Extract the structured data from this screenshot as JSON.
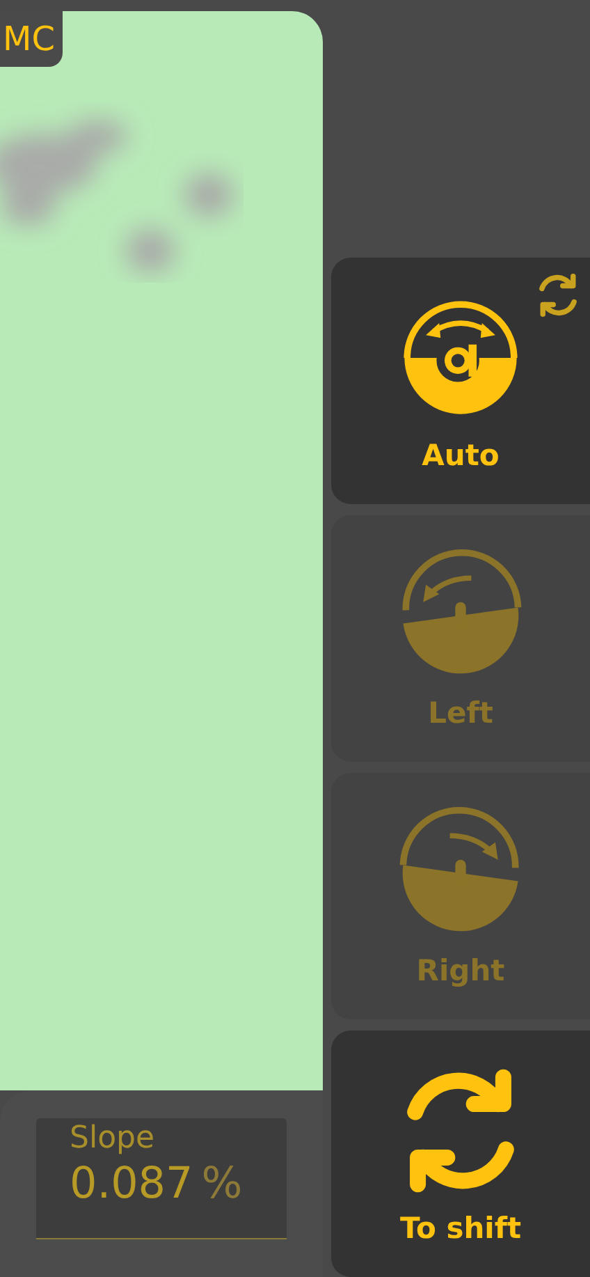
{
  "map": {
    "badge": "MC"
  },
  "slope": {
    "label": "Slope",
    "value": "0.087",
    "unit": "%"
  },
  "buttons": [
    {
      "kind": "auto",
      "label": "Auto",
      "disabled": false,
      "sync_badge": true
    },
    {
      "kind": "left",
      "label": "Left",
      "disabled": true,
      "sync_badge": false
    },
    {
      "kind": "right",
      "label": "Right",
      "disabled": true,
      "sync_badge": false
    },
    {
      "kind": "shift",
      "label": "To shift",
      "disabled": false,
      "sync_badge": false
    }
  ]
}
